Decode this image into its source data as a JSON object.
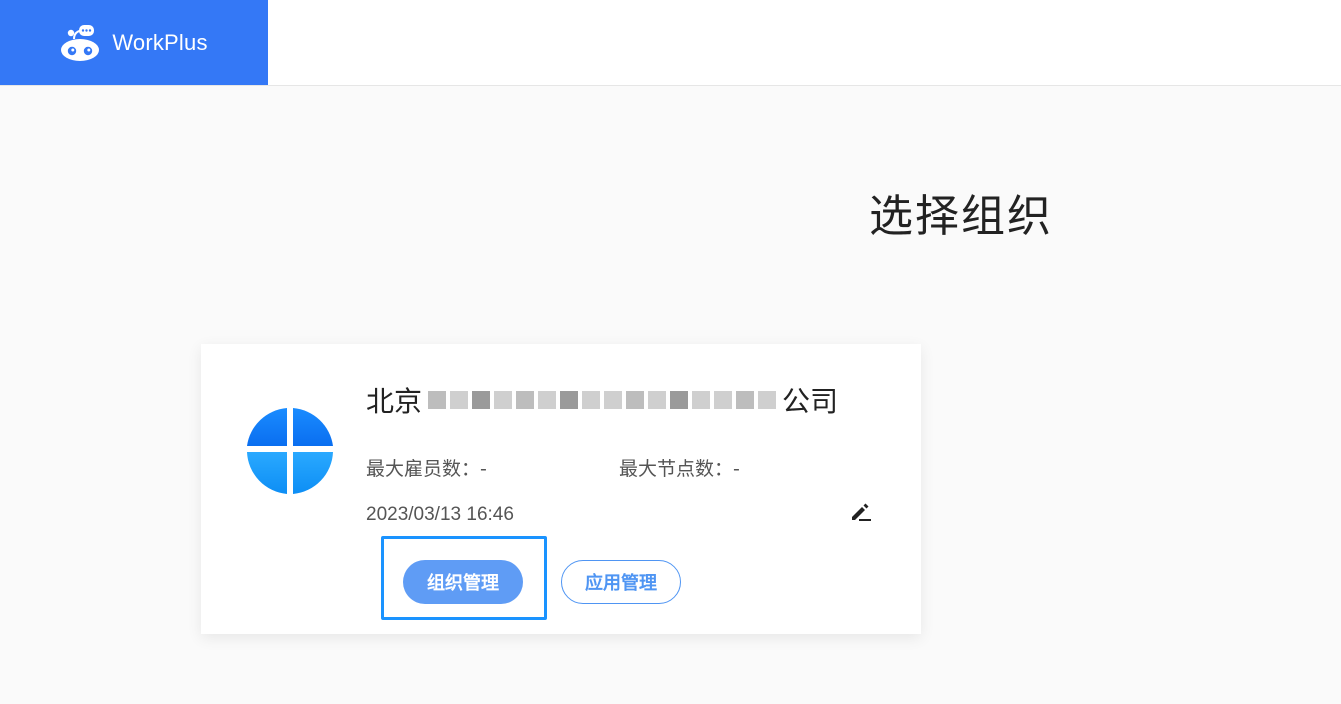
{
  "header": {
    "brand_name": "WorkPlus",
    "brand_color": "#3478f6",
    "logo_icon": "workplus-robot-logo"
  },
  "main": {
    "title": "选择组织"
  },
  "org_card": {
    "name_prefix": "北京",
    "name_suffix": "公司",
    "name_redacted": true,
    "logo_icon": "org-quadrant-logo",
    "max_employees": "最大雇员数：-",
    "max_nodes": "最大节点数：-",
    "created_at": "2023/03/13 16:46",
    "edit_icon": "pencil-edit-icon",
    "org_manage_label": "组织管理",
    "app_manage_label": "应用管理",
    "highlight_color": "#1a93ff"
  }
}
